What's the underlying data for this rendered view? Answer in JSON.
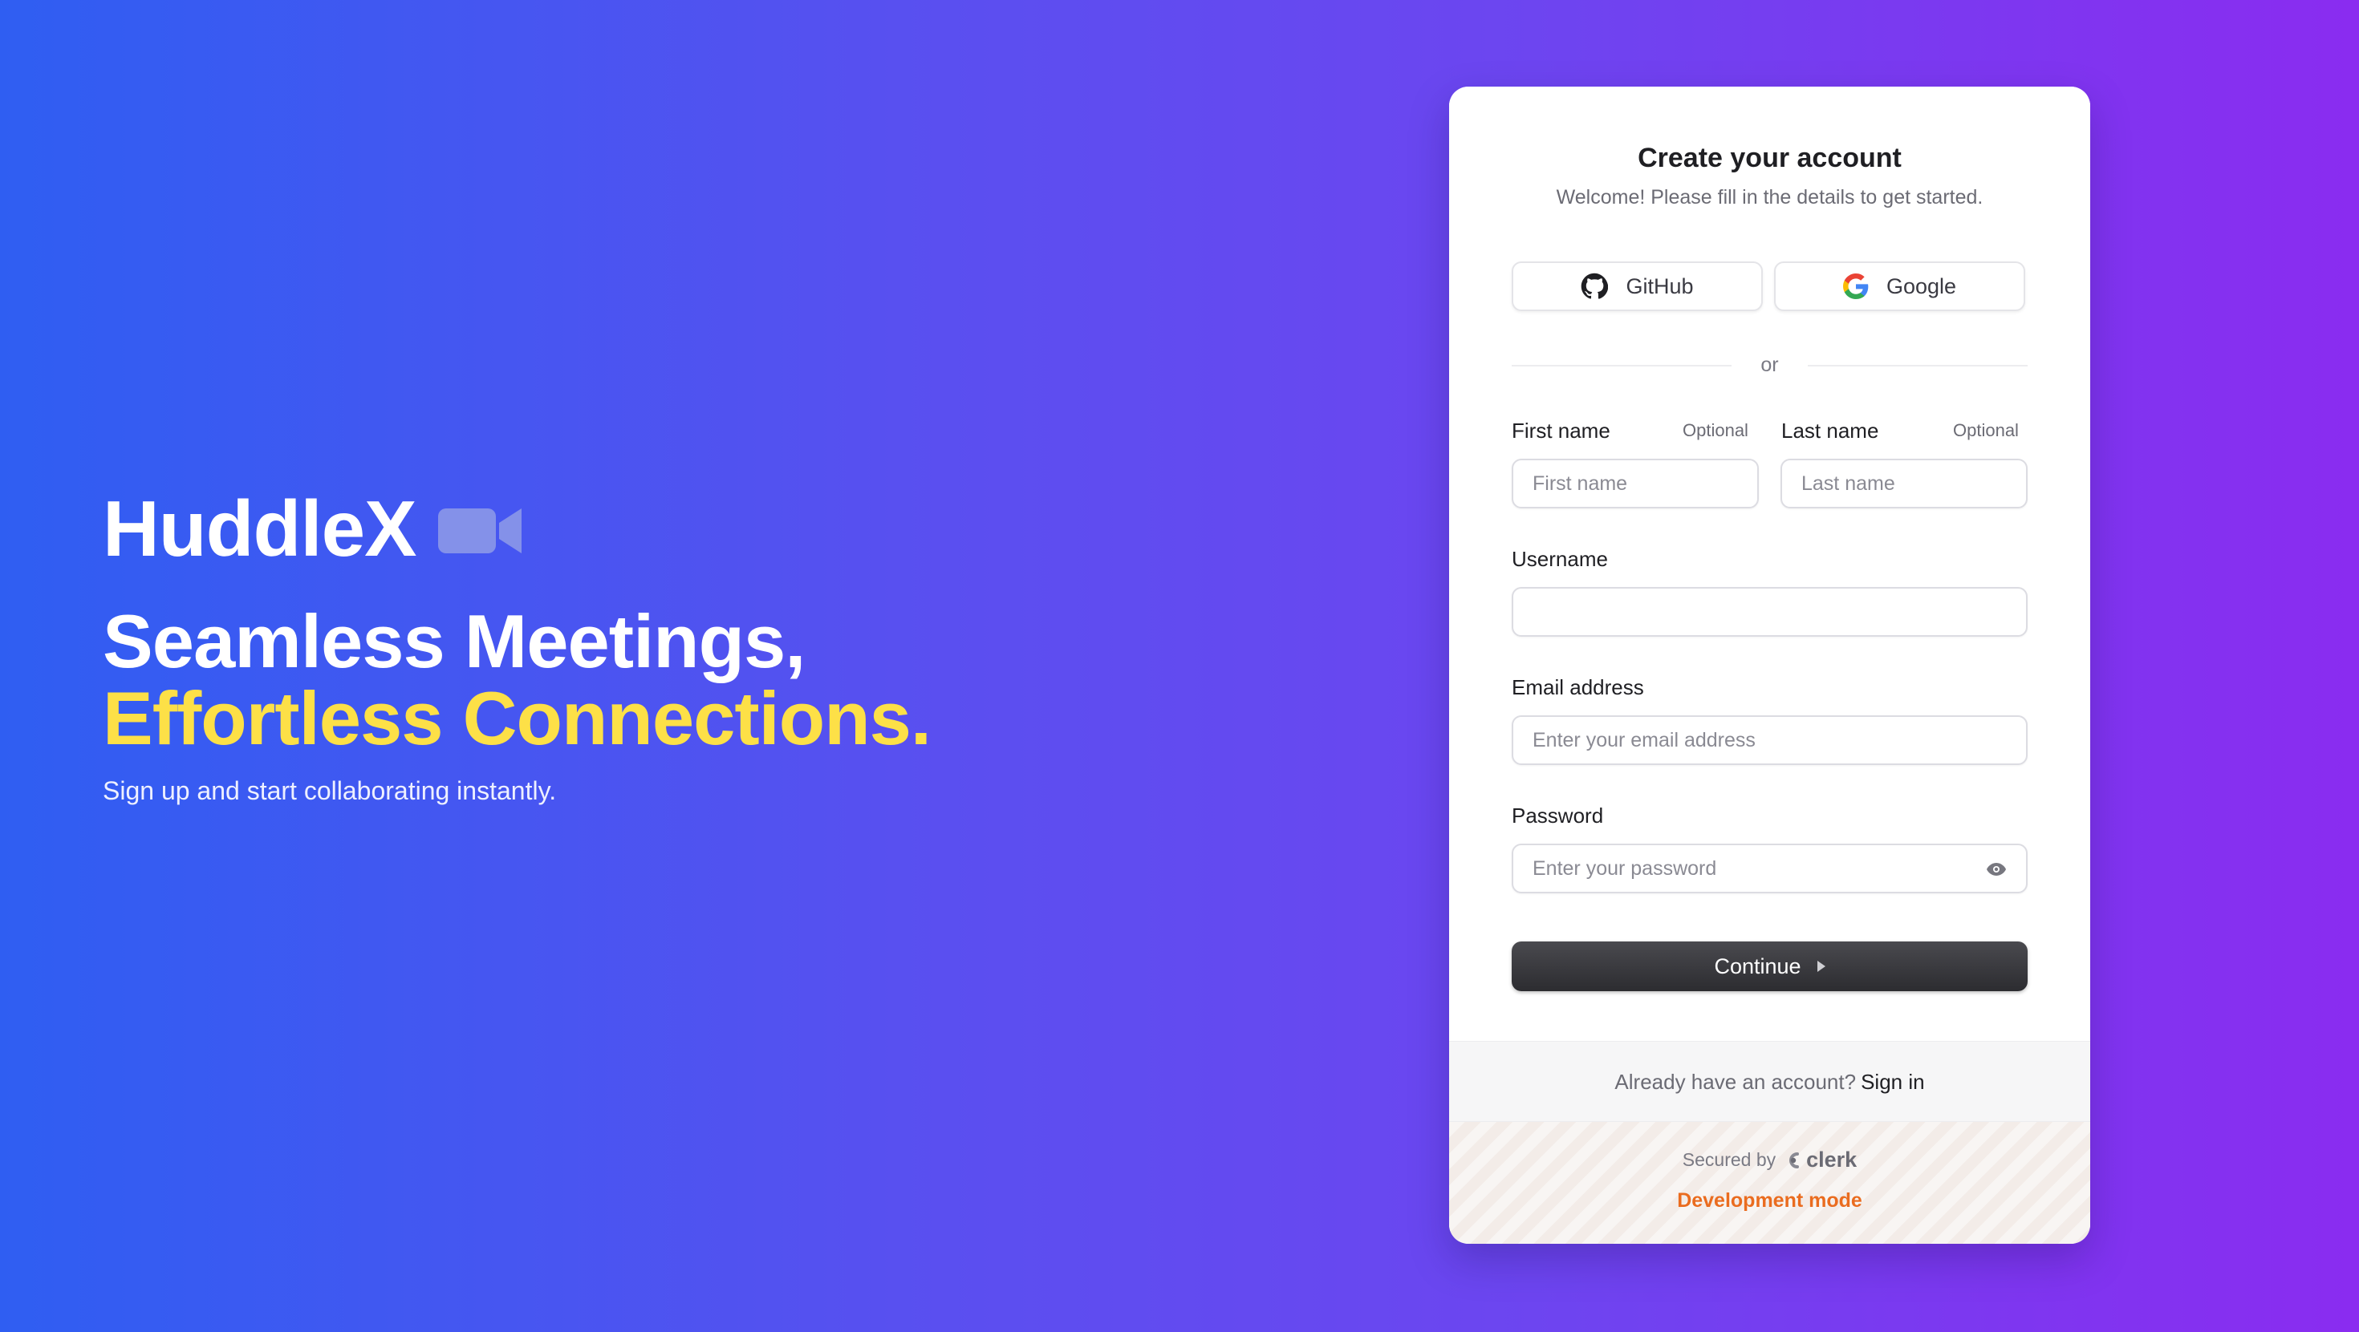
{
  "hero": {
    "brand": "HuddleX",
    "headline_line1": "Seamless Meetings,",
    "headline_line2": "Effortless Connections.",
    "tagline": "Sign up and start collaborating instantly."
  },
  "signup": {
    "title": "Create your account",
    "subtitle": "Welcome! Please fill in the details to get started.",
    "github_label": "GitHub",
    "google_label": "Google",
    "divider_text": "or",
    "first_name_label": "First name",
    "first_name_optional": "Optional",
    "first_name_placeholder": "First name",
    "last_name_label": "Last name",
    "last_name_optional": "Optional",
    "last_name_placeholder": "Last name",
    "username_label": "Username",
    "username_value": "",
    "email_label": "Email address",
    "email_placeholder": "Enter your email address",
    "password_label": "Password",
    "password_placeholder": "Enter your password",
    "continue_label": "Continue"
  },
  "footer": {
    "already_text": "Already have an account?",
    "signin_link": "Sign in",
    "secured_by": "Secured by",
    "clerk_brand": "clerk",
    "dev_mode": "Development mode"
  },
  "colors": {
    "accent_yellow": "#fde047",
    "dev_mode_orange": "#ea6c1f",
    "button_dark": "#2c2c30"
  },
  "icons": [
    "video-camera-icon",
    "github-icon",
    "google-icon",
    "eye-icon",
    "play-triangle-icon",
    "clerk-logo-icon"
  ]
}
